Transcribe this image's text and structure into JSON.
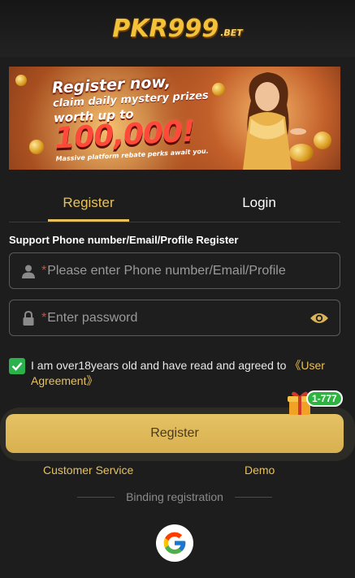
{
  "header": {
    "logo_text": "PKR999",
    "logo_suffix": ".BET",
    "logo_color": "#f3c13a"
  },
  "banner": {
    "line1": "Register now,",
    "line2": "claim daily mystery prizes",
    "line3": "worth up to",
    "amount": "100,000!",
    "subtext": "Massive platform rebate perks await you."
  },
  "tabs": {
    "register": "Register",
    "login": "Login",
    "active": "register"
  },
  "form": {
    "support_label": "Support Phone number/Email/Profile Register",
    "required_mark": "*",
    "phone_placeholder": "Please enter Phone number/Email/Profile",
    "phone_value": "",
    "password_placeholder": "Enter password",
    "password_value": "",
    "agreement_checked": true,
    "agreement_text": "I am over18years old and have read and agreed to ",
    "agreement_link": "《User Agreement》",
    "submit_label": "Register"
  },
  "gift": {
    "badge": "1-777"
  },
  "footer": {
    "customer_service": "Customer Service",
    "demo": "Demo",
    "binding_label": "Binding registration"
  },
  "colors": {
    "accent": "#e8c15d",
    "background": "#1d1d1d",
    "check": "#2bb24c",
    "required": "#d84a3a"
  },
  "icons": [
    "user-icon",
    "lock-icon",
    "eye-icon",
    "check-icon",
    "gift-icon",
    "google-icon"
  ]
}
